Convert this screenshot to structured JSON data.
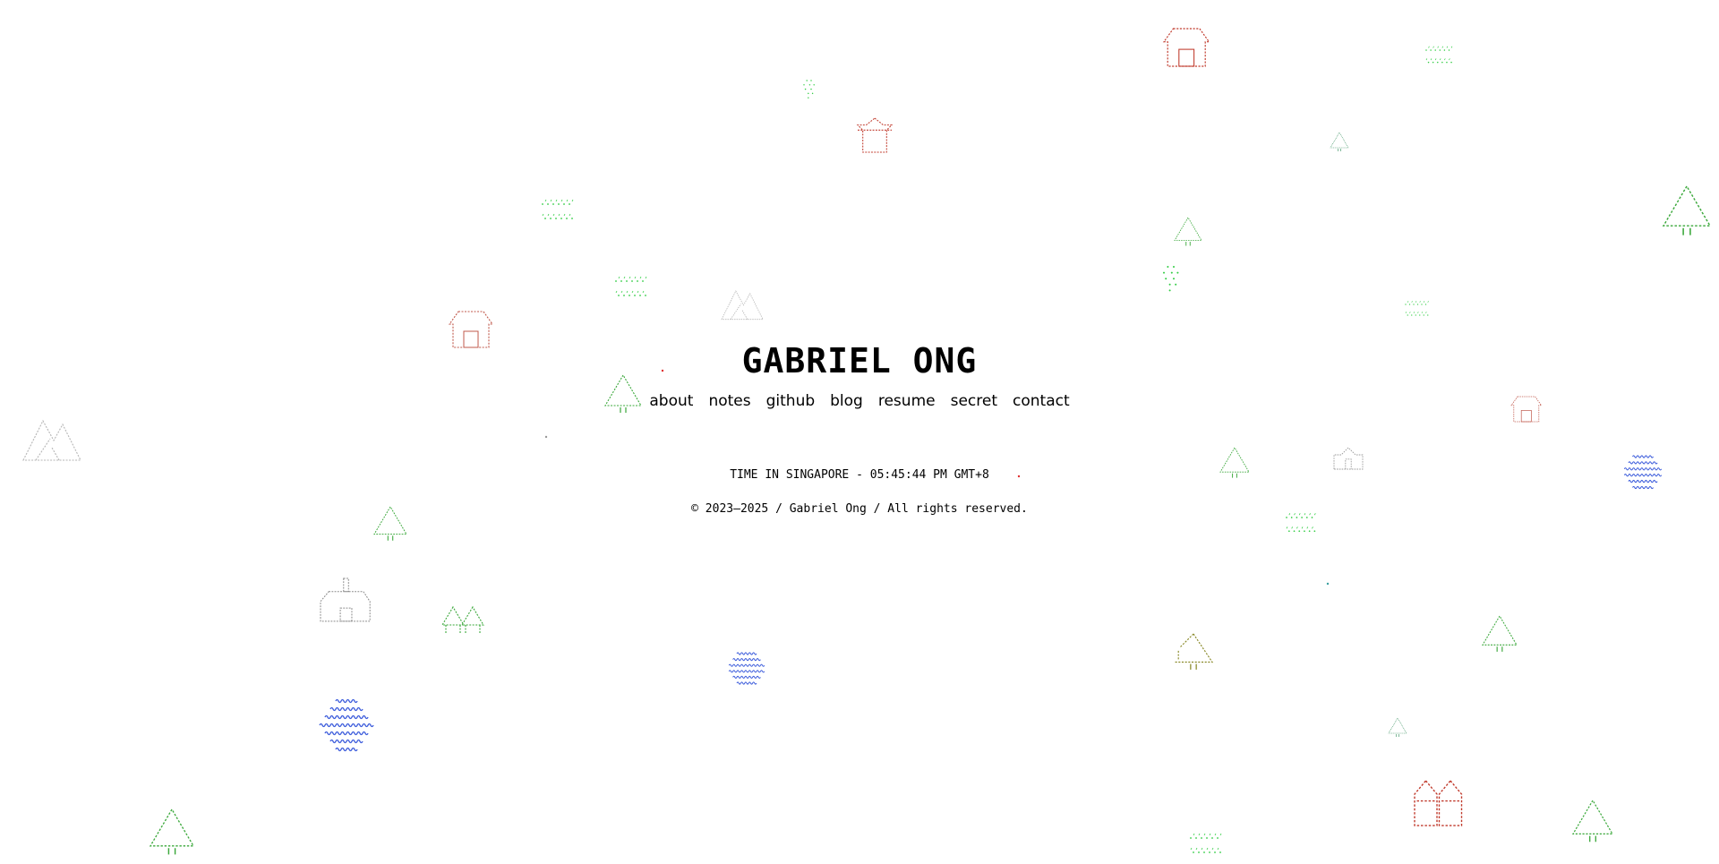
{
  "site": {
    "title": "GABRIEL ONG"
  },
  "nav": {
    "items": [
      {
        "label": "about"
      },
      {
        "label": "notes"
      },
      {
        "label": "github"
      },
      {
        "label": "blog"
      },
      {
        "label": "resume"
      },
      {
        "label": "secret"
      },
      {
        "label": "contact"
      }
    ]
  },
  "footer": {
    "time_text": "TIME IN SINGAPORE - 05:45:44 PM GMT+8",
    "copyright": "© 2023–2025 / Gabriel Ong / All rights reserved."
  },
  "colors": {
    "tree": "#3aa83a",
    "house": "#c0392b",
    "mountain": "#b5b5b5",
    "water": "#3b5bdb",
    "grass": "#2ecc40",
    "olive": "#8a8a2a"
  }
}
